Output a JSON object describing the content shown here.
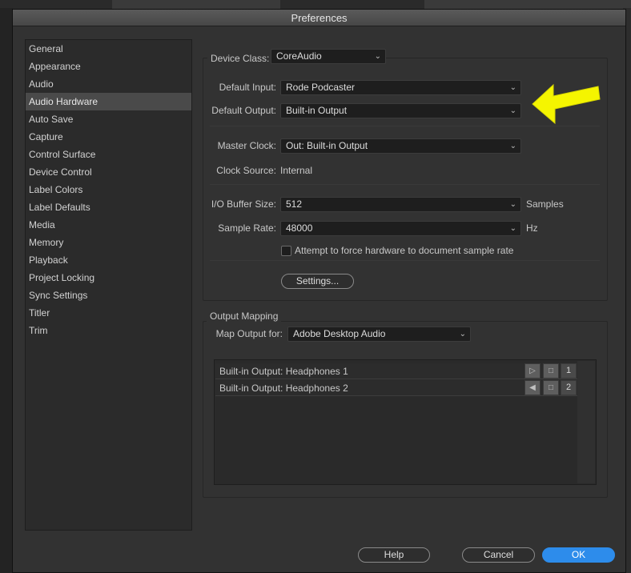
{
  "window": {
    "title": "Preferences"
  },
  "sidebar": {
    "items": [
      {
        "label": "General"
      },
      {
        "label": "Appearance"
      },
      {
        "label": "Audio"
      },
      {
        "label": "Audio Hardware",
        "selected": true
      },
      {
        "label": "Auto Save"
      },
      {
        "label": "Capture"
      },
      {
        "label": "Control Surface"
      },
      {
        "label": "Device Control"
      },
      {
        "label": "Label Colors"
      },
      {
        "label": "Label Defaults"
      },
      {
        "label": "Media"
      },
      {
        "label": "Memory"
      },
      {
        "label": "Playback"
      },
      {
        "label": "Project Locking"
      },
      {
        "label": "Sync Settings"
      },
      {
        "label": "Titler"
      },
      {
        "label": "Trim"
      }
    ]
  },
  "hardware": {
    "device_class_label": "Device Class:",
    "device_class_value": "CoreAudio",
    "default_input_label": "Default Input:",
    "default_input_value": "Rode Podcaster",
    "default_output_label": "Default Output:",
    "default_output_value": "Built-in Output",
    "master_clock_label": "Master Clock:",
    "master_clock_value": "Out: Built-in Output",
    "clock_source_label": "Clock Source:",
    "clock_source_value": "Internal",
    "buffer_size_label": "I/O Buffer Size:",
    "buffer_size_value": "512",
    "buffer_size_unit": "Samples",
    "sample_rate_label": "Sample Rate:",
    "sample_rate_value": "48000",
    "sample_rate_unit": "Hz",
    "force_rate_label": "Attempt to force hardware to document sample rate",
    "force_rate_checked": false,
    "settings_button": "Settings..."
  },
  "output_mapping": {
    "title": "Output Mapping",
    "map_for_label": "Map Output for:",
    "map_for_value": "Adobe Desktop Audio",
    "rows": [
      {
        "label": "Built-in Output: Headphones 1",
        "channel": "1"
      },
      {
        "label": "Built-in Output: Headphones 2",
        "channel": "2"
      }
    ]
  },
  "footer": {
    "help_label": "Help",
    "cancel_label": "Cancel",
    "ok_label": "OK"
  },
  "colors": {
    "accent": "#2d8ceb",
    "annotation_arrow": "#f5f500"
  },
  "icons": {
    "dropdown": "chevron-down-icon",
    "row_icons": [
      "speaker-icon",
      "output-mapping-icon"
    ],
    "annotation": "arrow-left-icon"
  }
}
